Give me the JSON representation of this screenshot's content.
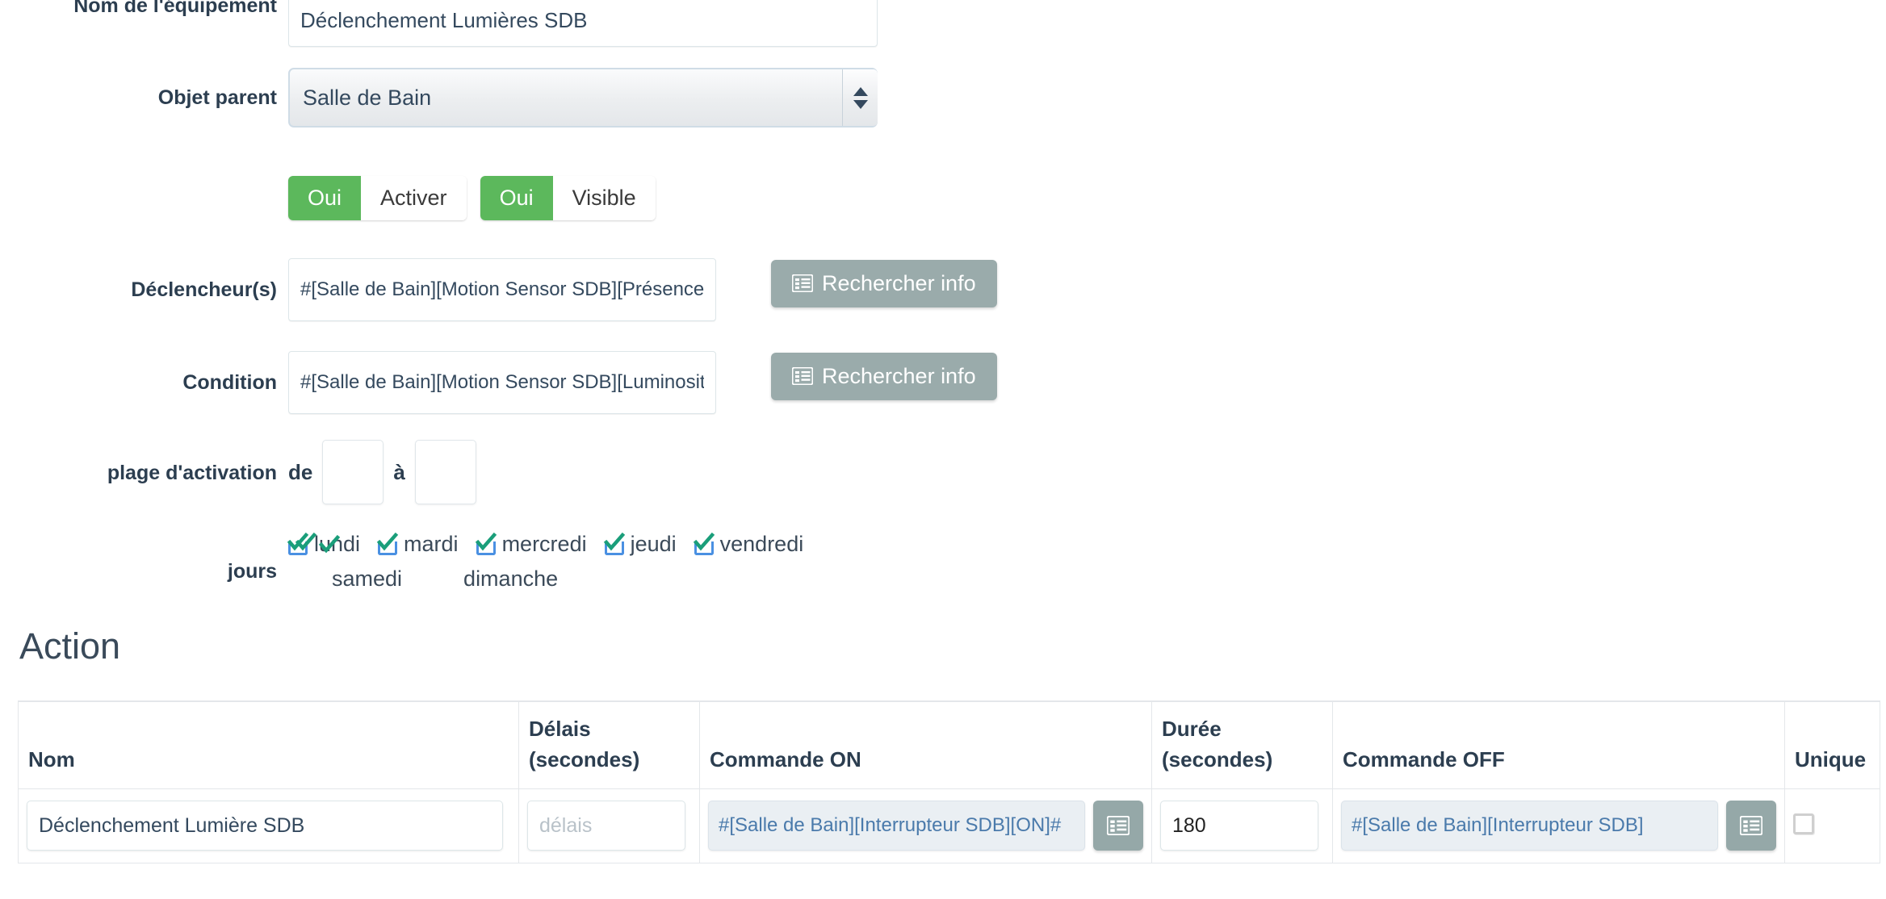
{
  "form": {
    "name_label": "Nom de l'équipement",
    "name_value": "Déclenchement Lumières SDB",
    "parent_label": "Objet parent",
    "parent_value": "Salle de Bain",
    "parent_options": [
      "Salle de Bain"
    ],
    "toggles": [
      {
        "on_label": "Oui",
        "name_label": "Activer",
        "state": "on"
      },
      {
        "on_label": "Oui",
        "name_label": "Visible",
        "state": "on"
      }
    ],
    "trigger_label": "Déclencheur(s)",
    "trigger_value": "#[Salle de Bain][Motion Sensor SDB][Présence]#",
    "trigger_button": "Rechercher info",
    "condition_label": "Condition",
    "condition_value": "#[Salle de Bain][Motion Sensor SDB][Luminosité]#",
    "condition_button": "Rechercher info",
    "plage_label": "plage d'activation",
    "plage_from_word": "de",
    "plage_to_word": "à",
    "plage_from_value": "",
    "plage_to_value": "",
    "days_label": "jours",
    "days": [
      {
        "label": "lundi",
        "checked": true,
        "double": true
      },
      {
        "label": "mardi",
        "checked": true,
        "double": true
      },
      {
        "label": "mercredi",
        "checked": true,
        "double": false
      },
      {
        "label": "jeudi",
        "checked": true,
        "double": false
      },
      {
        "label": "vendredi",
        "checked": true,
        "double": false
      },
      {
        "label": "samedi",
        "checked": false,
        "double": false
      },
      {
        "label": "dimanche",
        "checked": false,
        "double": false
      }
    ]
  },
  "action": {
    "heading": "Action",
    "columns": [
      "Nom",
      "Délais\n(secondes)",
      "Commande ON",
      "Durée\n(secondes)",
      "Commande OFF",
      "Unique"
    ],
    "col_delais_line1": "Délais",
    "col_delais_line2": "(secondes)",
    "col_duree_line1": "Durée",
    "col_duree_line2": "(secondes)",
    "col_nom": "Nom",
    "col_on": "Commande ON",
    "col_off": "Commande OFF",
    "col_unique": "Unique",
    "rows": [
      {
        "nom": "Déclenchement Lumière SDB",
        "delais": "",
        "delais_placeholder": "délais",
        "commande_on": "#[Salle de Bain][Interrupteur SDB][ON]#",
        "duree": "180",
        "commande_off": "#[Salle de Bain][Interrupteur SDB]",
        "unique": false
      }
    ]
  },
  "icons": {
    "list_icon": "list-icon",
    "select_arrows": "spinner-arrows-icon",
    "checkbox_checked": "check-icon",
    "checkbox_empty": "empty-checkbox-icon"
  },
  "colors": {
    "accent_green": "#5cb85c",
    "button_gray": "#9aabab",
    "text_dark": "#2c3e50",
    "cmd_text_blue": "#4a7aab",
    "cmd_bg": "#eaeff3",
    "check_green": "#1a9e7a",
    "check_blue": "#4a90e2"
  }
}
